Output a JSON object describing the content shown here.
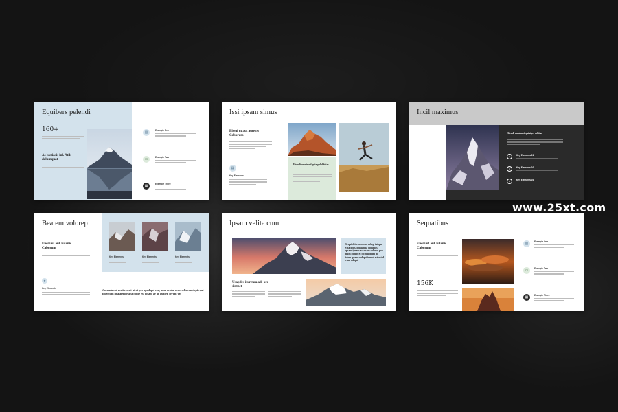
{
  "watermark": "www.25xt.com",
  "colors": {
    "background": "#141414",
    "slide": "#ffffff",
    "pale_blue": "#d3e2ec",
    "pale_green": "#dceadb",
    "dark_panel": "#2a2a2a"
  },
  "slides": [
    {
      "title": "Equibers pelendi",
      "stat": "160+",
      "subhead": "As luctiasis inl. Atils dolumquat",
      "items": [
        "Example One",
        "Example Two",
        "Example Three"
      ]
    },
    {
      "title": "Issi ipsam simus",
      "subhead": "Eheni ut aut autenis Caborum",
      "key_label": "Key Elements",
      "box_head": "Ehendi omnimod quiatpel debitas"
    },
    {
      "title": "Incil maximus",
      "box_head": "Ehendi omnimod quiatpel debitas",
      "items": [
        "Key Elements 01",
        "Key Elements 02",
        "Key Elements 03"
      ]
    },
    {
      "title": "Beatem volorep",
      "subhead": "Eheni ut aut autenis Caborum",
      "key_label": "Key Elements",
      "photo_labels": [
        "Key Elements",
        "Key Elements",
        "Key Elements"
      ],
      "quote": "Um audaessi restiis rexit ut ut per aped qui con, aum re sim acae velis conetepis qui dellectum quaspero exiist conse est ipsam ae ae quaten rerum vel"
    },
    {
      "title": "Ipsam velita cum",
      "callout": "Sequi ditis non con volup-tatque vitatibus, odiiaquia commos quam ipsam accusam solorat pro num quunt et ficimilorum de idem quam sed quibus ut est estid cum ad qui",
      "subhead": "Usapdes iturrum adi-ore sintnet"
    },
    {
      "title": "Sequatibus",
      "subhead": "Eheni ut aut autenis Caborum",
      "stat": "156K",
      "items": [
        "Example One",
        "Example Two",
        "Example Three"
      ]
    }
  ]
}
